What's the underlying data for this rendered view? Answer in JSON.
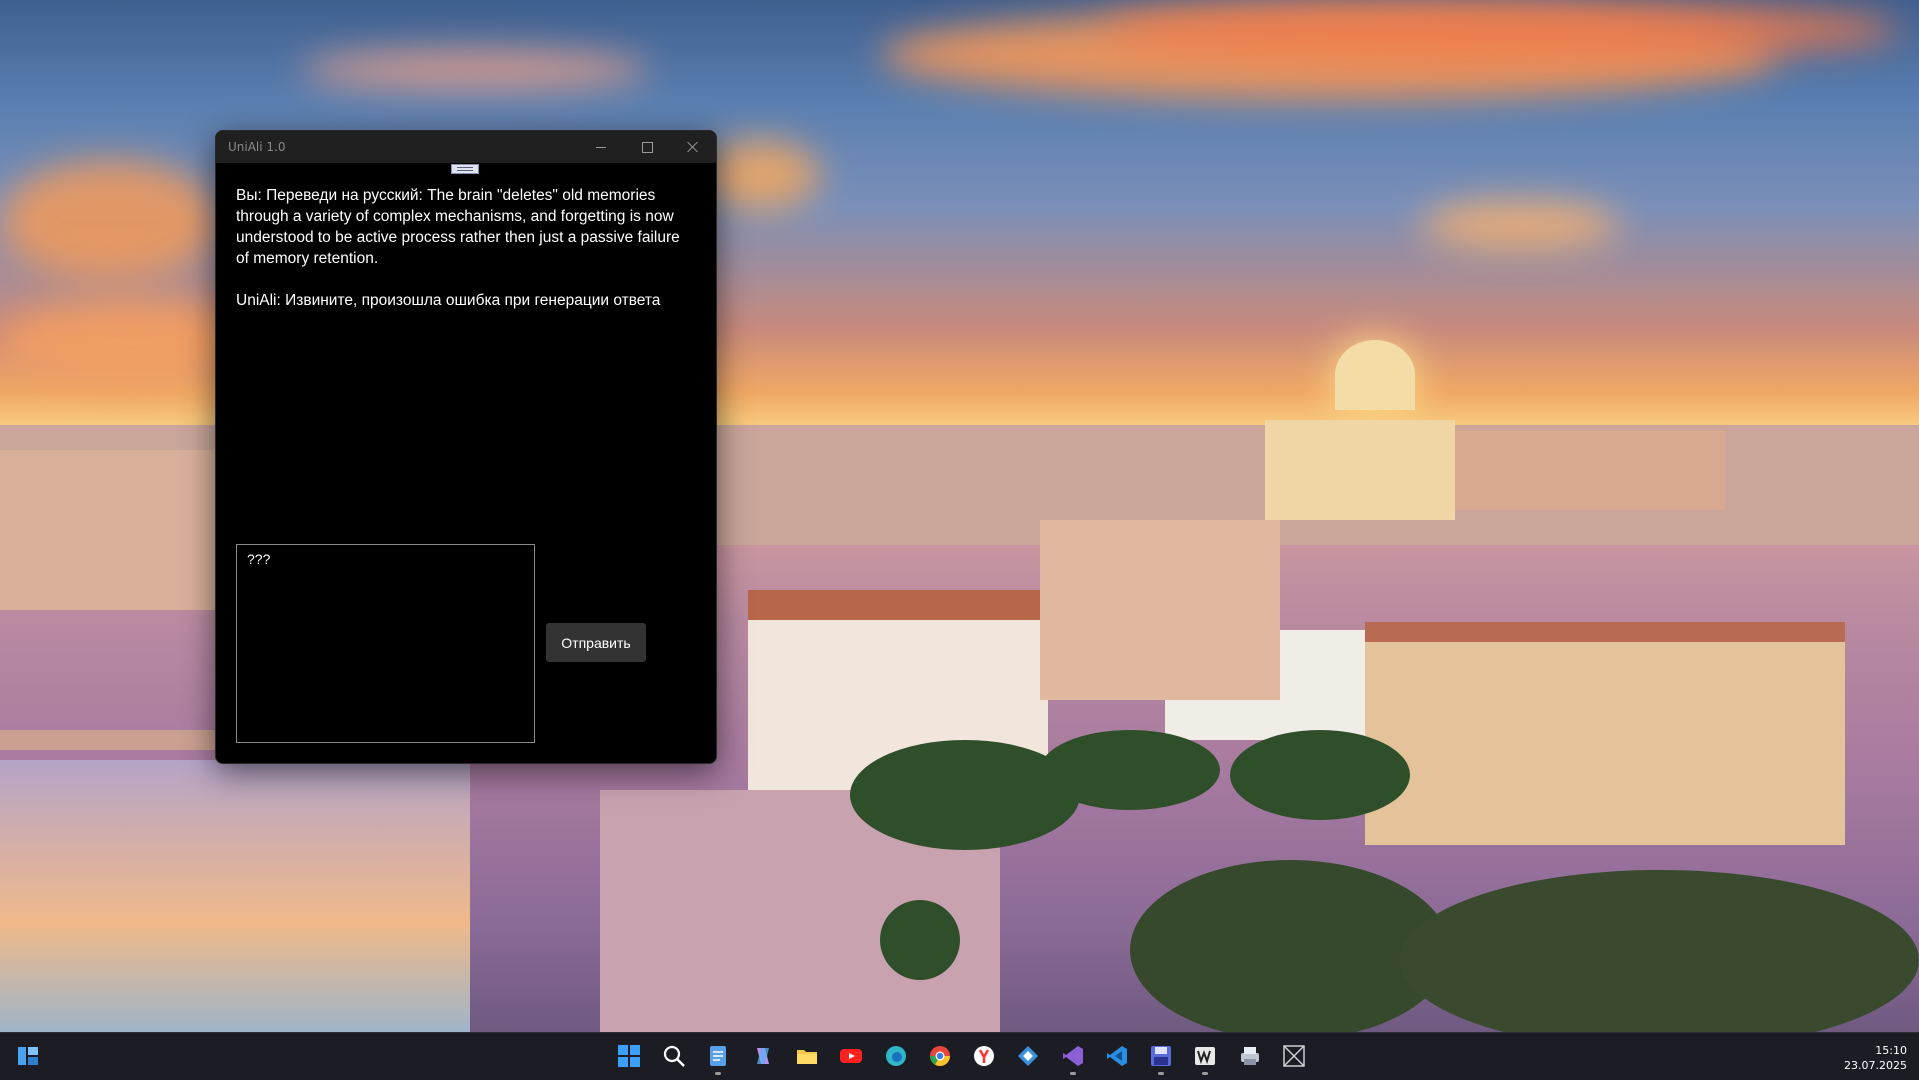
{
  "window": {
    "title": "UniAli 1.0"
  },
  "chat": {
    "messages": [
      "Вы: Переведи на русский: The brain \"deletes\" old memories through a variety of complex mechanisms, and forgetting is now understood to be active process rather then just a passive failure of memory retention.",
      "UniAli: Извините, произошла ошибка при генерации ответа"
    ]
  },
  "input": {
    "value": "???"
  },
  "send_button": {
    "label": "Отправить"
  },
  "taskbar": {
    "items": [
      {
        "name": "widgets-icon",
        "color": "#4aa3f0"
      },
      {
        "name": "start-icon",
        "color": "#3ba0ff"
      },
      {
        "name": "search-icon",
        "color": "#ffffff"
      },
      {
        "name": "notepad-icon",
        "color": "#5aa0e8"
      },
      {
        "name": "copilot-icon",
        "color": "#c58af0"
      },
      {
        "name": "file-explorer-icon",
        "color": "#f5c84a"
      },
      {
        "name": "youtube-icon",
        "color": "#ff2020"
      },
      {
        "name": "edge-icon",
        "color": "#2fb7c9"
      },
      {
        "name": "chrome-icon",
        "color": "#e8453c"
      },
      {
        "name": "yandex-browser-icon",
        "color": "#ff3333"
      },
      {
        "name": "app-diamond-icon",
        "color": "#3a8fe0"
      },
      {
        "name": "visual-studio-icon",
        "color": "#8b5fd6"
      },
      {
        "name": "vscode-icon",
        "color": "#2a8fe0"
      },
      {
        "name": "save-app-icon",
        "color": "#5a6ad8"
      },
      {
        "name": "wps-icon",
        "color": "#e8e8e8"
      },
      {
        "name": "printer-app-icon",
        "color": "#bfc6d2"
      },
      {
        "name": "image-placeholder-icon",
        "color": "#cfcfcf"
      }
    ]
  },
  "clock": {
    "time": "15:10",
    "date": "23.07.2025"
  }
}
